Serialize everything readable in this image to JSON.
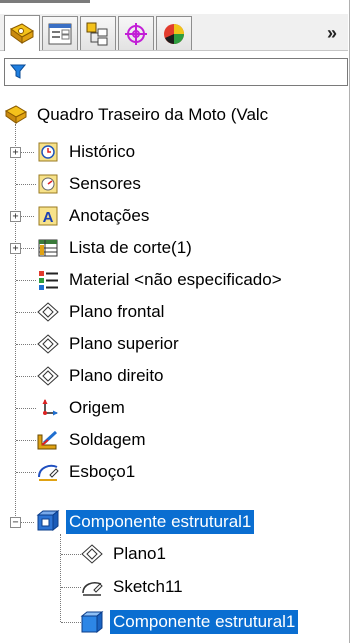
{
  "toolbar": {
    "tabs": [
      {
        "name": "feature-manager-icon",
        "active": true
      },
      {
        "name": "property-manager-icon",
        "active": false
      },
      {
        "name": "configuration-manager-icon",
        "active": false
      },
      {
        "name": "dimxpert-manager-icon",
        "active": false
      },
      {
        "name": "display-manager-icon",
        "active": false
      }
    ],
    "more_label": "»"
  },
  "filter": {
    "icon": "filter-icon"
  },
  "tree": {
    "root": {
      "label": "Quadro Traseiro da Moto  (Valc",
      "icon": "part-icon"
    },
    "items": [
      {
        "label": "Histórico",
        "icon": "history-icon",
        "expandable": true
      },
      {
        "label": "Sensores",
        "icon": "sensors-icon",
        "expandable": false
      },
      {
        "label": "Anotações",
        "icon": "annotations-icon",
        "expandable": true
      },
      {
        "label": "Lista de corte(1)",
        "icon": "cut-list-icon",
        "expandable": true
      },
      {
        "label": "Material <não especificado>",
        "icon": "material-icon",
        "expandable": false
      },
      {
        "label": "Plano frontal",
        "icon": "plane-icon",
        "expandable": false
      },
      {
        "label": "Plano superior",
        "icon": "plane-icon",
        "expandable": false
      },
      {
        "label": "Plano direito",
        "icon": "plane-icon",
        "expandable": false
      },
      {
        "label": "Origem",
        "icon": "origin-icon",
        "expandable": false
      },
      {
        "label": "Soldagem",
        "icon": "weldment-icon",
        "expandable": false
      },
      {
        "label": "Esboço1",
        "icon": "sketch-icon",
        "expandable": false
      },
      {
        "label": "Componente estrutural1",
        "icon": "structural-member-icon",
        "expandable": true,
        "expanded": true,
        "selected": true
      }
    ],
    "children": [
      {
        "label": "Plano1",
        "icon": "plane-icon"
      },
      {
        "label": "Sketch11",
        "icon": "sketch-icon"
      },
      {
        "label": "Componente estrutural1",
        "icon": "body-icon",
        "selected": true
      }
    ]
  },
  "colors": {
    "selection": "#0a6ed1",
    "tree_lines": "#7a7a7a"
  }
}
